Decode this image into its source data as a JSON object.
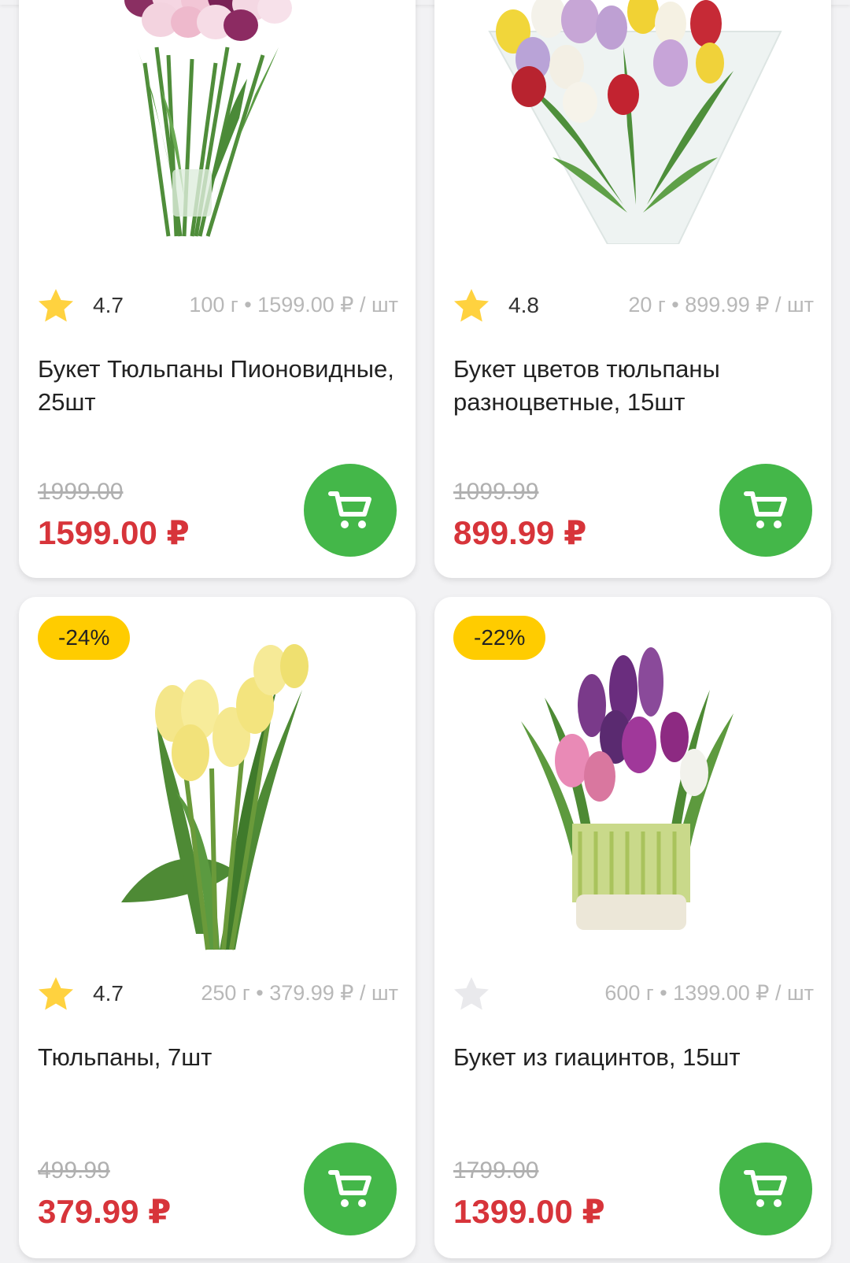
{
  "colors": {
    "background": "#f2f2f4",
    "card": "#ffffff",
    "price_red": "#d7343a",
    "cart_green": "#44b749",
    "discount_yellow": "#ffcc00",
    "star_yellow": "#ffd23f",
    "star_empty": "#e9e9ec",
    "muted_text": "#b8b8b8"
  },
  "products": [
    {
      "image_icon": "pink-peony-tulips-bouquet-image",
      "rating": "4.7",
      "rated": true,
      "unit_info": "100 г • 1599.00 ₽ / шт",
      "title": "Букет Тюльпаны Пионовидные, 25шт",
      "old_price": "1999.00",
      "price": "1599.00 ₽",
      "discount": ""
    },
    {
      "image_icon": "mixed-color-tulips-bouquet-image",
      "rating": "4.8",
      "rated": true,
      "unit_info": "20 г • 899.99 ₽ / шт",
      "title": "Букет цветов тюльпаны разноцветные, 15шт",
      "old_price": "1099.99",
      "price": "899.99 ₽",
      "discount": ""
    },
    {
      "image_icon": "yellow-tulips-image",
      "rating": "4.7",
      "rated": true,
      "unit_info": "250 г • 379.99 ₽ / шт",
      "title": "Тюльпаны, 7шт",
      "old_price": "499.99",
      "price": "379.99 ₽",
      "discount": "-24%"
    },
    {
      "image_icon": "hyacinths-bouquet-image",
      "rating": "",
      "rated": false,
      "unit_info": "600 г • 1399.00 ₽ / шт",
      "title": "Букет из гиацинтов, 15шт",
      "old_price": "1799.00",
      "price": "1399.00 ₽",
      "discount": "-22%"
    }
  ]
}
